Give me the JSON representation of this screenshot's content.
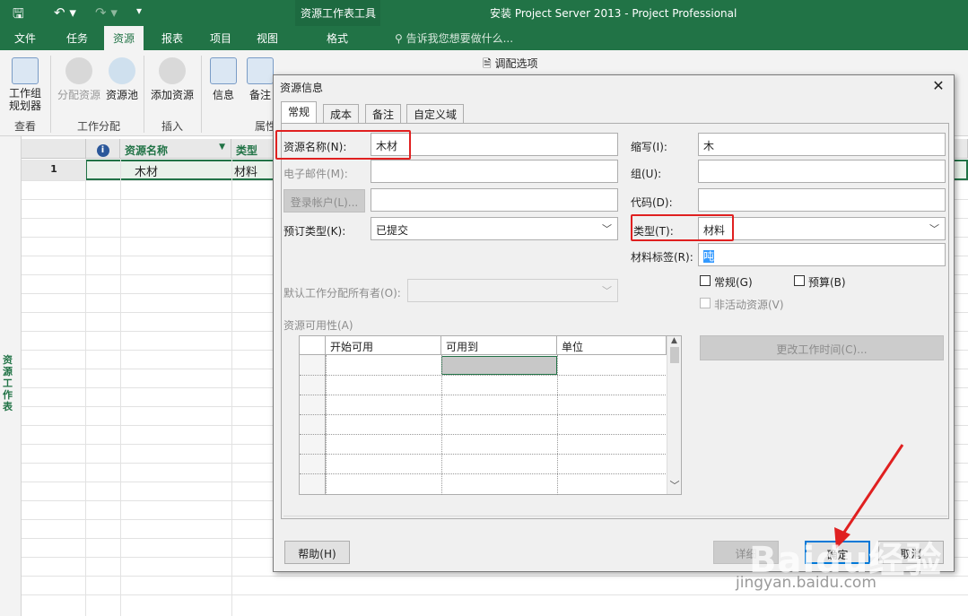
{
  "title_bar": {
    "contextual_tab": "资源工作表工具",
    "window_title": "安装 Project Server 2013 - Project Professional"
  },
  "tabs": {
    "file": "文件",
    "task": "任务",
    "resource": "资源",
    "report": "报表",
    "project": "项目",
    "view": "视图",
    "format": "格式",
    "tell_me": "告诉我您想要做什么..."
  },
  "ribbon": {
    "team_planner": "工作组\n规划器",
    "assign_resources": "分配资源",
    "resource_pool": "资源池",
    "add_resources": "添加资源",
    "information": "信息",
    "notes": "备注",
    "leveling_options": "调配选项",
    "group_view": "查看",
    "group_assignments": "工作分配",
    "group_insert": "插入",
    "group_properties": "属性"
  },
  "sheet": {
    "side_label": "资源工作表",
    "col_info": "i",
    "col_name": "资源名称",
    "col_type": "类型",
    "row1_id": "1",
    "row1_name": "木材",
    "row1_type": "材料"
  },
  "dialog": {
    "title": "资源信息",
    "tabs": [
      "常规",
      "成本",
      "备注",
      "自定义域"
    ],
    "resource_name_label": "资源名称(N):",
    "resource_name_value": "木材",
    "email_label": "电子邮件(M):",
    "login_button": "登录帐户(L)...",
    "booking_label": "预订类型(K):",
    "booking_value": "已提交",
    "default_owner_label": "默认工作分配所有者(O):",
    "availability_label": "资源可用性(A)",
    "avail_cols": [
      "开始可用",
      "可用到",
      "单位"
    ],
    "initials_label": "缩写(I):",
    "initials_value": "木",
    "group_label": "组(U):",
    "code_label": "代码(D):",
    "type_label": "类型(T):",
    "type_value": "材料",
    "material_label": "材料标签(R):",
    "material_value": "吨",
    "generic_label": "常规(G)",
    "budget_label": "预算(B)",
    "inactive_label": "非活动资源(V)",
    "change_time_button": "更改工作时间(C)...",
    "help_button": "帮助(H)",
    "details_button": "详细",
    "ok_button": "确定",
    "cancel_button": "取消"
  },
  "watermark": {
    "brand": "Baidu经验",
    "url": "jingyan.baidu.com"
  }
}
